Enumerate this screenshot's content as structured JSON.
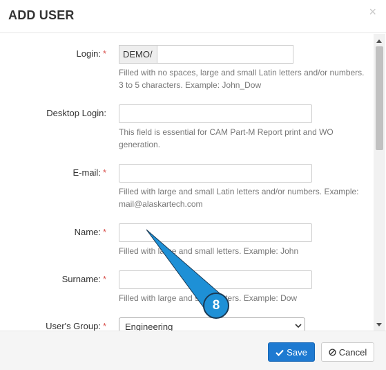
{
  "dialog": {
    "title": "ADD USER",
    "close_glyph": "×"
  },
  "fields": {
    "login": {
      "label": "Login:",
      "required": "*",
      "prefix": "DEMO/",
      "value": "",
      "help": "Filled with no spaces, large and small Latin letters and/or numbers. 3 to 5 characters. Example: John_Dow"
    },
    "desktop_login": {
      "label": "Desktop Login:",
      "value": "",
      "help": "This field is essential for CAM Part-M Report print and WO generation."
    },
    "email": {
      "label": "E-mail:",
      "required": "*",
      "value": "",
      "help": "Filled with large and small Latin letters and/or numbers. Example: mail@alaskartech.com"
    },
    "name": {
      "label": "Name:",
      "required": "*",
      "value": "",
      "help": "Filled with large and small letters. Example: John"
    },
    "surname": {
      "label": "Surname:",
      "required": "*",
      "value": "",
      "help": "Filled with large and small letters. Example: Dow"
    },
    "users_group": {
      "label": "User's Group:",
      "required": "*",
      "selected": "Engineering"
    }
  },
  "footer": {
    "save_label": "Save",
    "cancel_label": "Cancel"
  },
  "annotation": {
    "number": "8"
  },
  "colors": {
    "primary": "#1e7ad1",
    "required": "#d9534f",
    "callout": "#1e90d6"
  },
  "icons": {
    "save": "check-icon",
    "cancel": "ban-icon",
    "close": "close-icon",
    "select": "chevron-down-icon"
  }
}
